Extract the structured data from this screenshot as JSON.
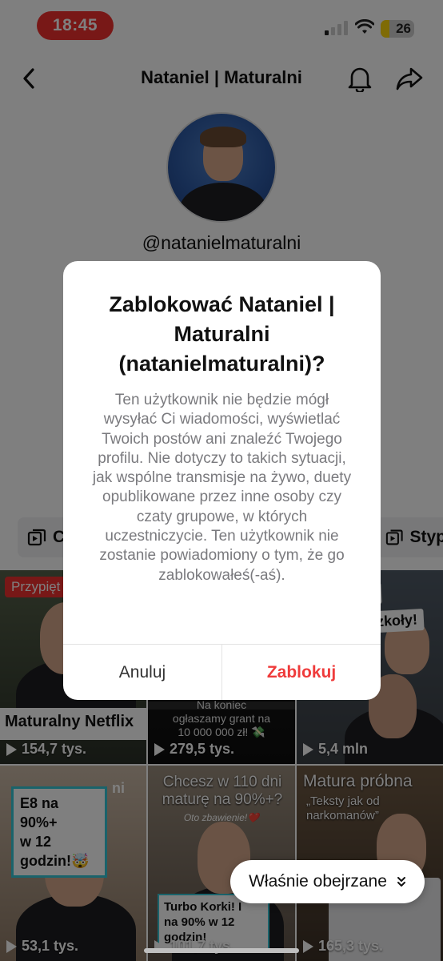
{
  "status_bar": {
    "time": "18:45",
    "battery": "26",
    "battery_level_percent": 26
  },
  "header": {
    "title": "Nataniel | Maturalni"
  },
  "profile": {
    "username": "@natanielmaturalni"
  },
  "chips": {
    "left_label": "C",
    "right_label": "Styp"
  },
  "videos": [
    {
      "badge": "Przypięt",
      "caption": "Maturalny Netflix",
      "views": "154,7 tys."
    },
    {
      "caption_lines": [
        "Na koniec",
        "ogłaszamy grant na",
        "10 000 000 zł! 💸"
      ],
      "views": "279,5 tys."
    },
    {
      "caption_lines": [
        "sk",
        "szkoły!"
      ],
      "views": "5,4 mln"
    },
    {
      "caption_lines": [
        "E8 na 90%+",
        "w 12 godzin!🤯"
      ],
      "corner_text": "ni",
      "views": "53,1 tys."
    },
    {
      "caption": "Chcesz w 110 dni maturę na 90%+?",
      "sub": "Oto zbawienie!❤️",
      "box_lines": [
        "Turbo Korki! I",
        "na 90% w 12 godzin!"
      ],
      "views": "101,7 tys."
    },
    {
      "caption": "Matura próbna",
      "sub_lines": [
        "„Teksty jak od",
        "narkomanów”"
      ],
      "views": "165,3 tys."
    }
  ],
  "dialog": {
    "title_lines": [
      "Zablokować Nataniel |",
      "Maturalni",
      "(natanielmaturalni)?"
    ],
    "body": "Ten użytkownik nie będzie mógł wysyłać Ci wiadomości, wyświetlać Twoich postów ani znaleźć Twojego profilu. Nie dotyczy to takich sytuacji, jak wspólne transmisje na żywo, duety opublikowane przez inne osoby czy czaty grupowe, w których uczestniczycie. Ten użytkownik nie zostanie powiadomiony o tym, że go zablokowałeś(-aś).",
    "cancel_label": "Anuluj",
    "block_label": "Zablokuj"
  },
  "recent_pill": {
    "label": "Właśnie obejrzane"
  },
  "colors": {
    "accent_red": "#f0312e",
    "block_red": "#ef3b3b",
    "battery_yellow": "#ffd60a"
  }
}
